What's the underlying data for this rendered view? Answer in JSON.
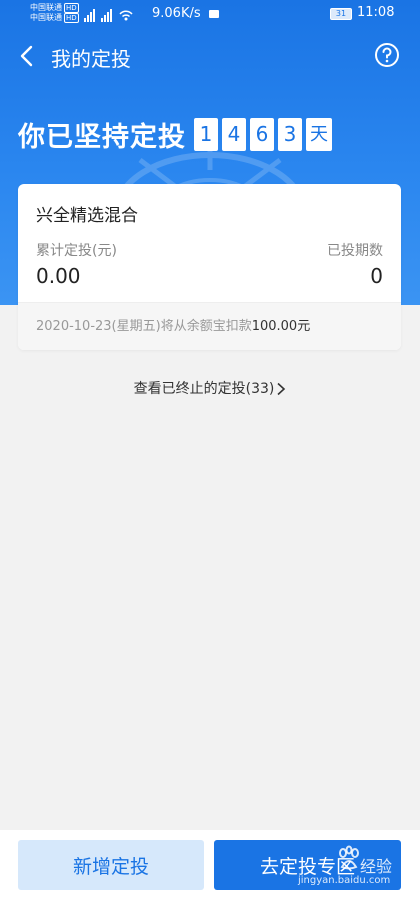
{
  "status_bar": {
    "carrier_1": "中国联通",
    "carrier_2": "中国联通",
    "hd_badge": "HD",
    "network_speed": "9.06K/s",
    "battery": "31",
    "time": "11:08"
  },
  "nav": {
    "title": "我的定投",
    "back_icon": "back-arrow-icon",
    "help_icon": "question-circle-icon"
  },
  "headline": {
    "text": "你已坚持定投",
    "digits": [
      "1",
      "4",
      "6",
      "3"
    ],
    "unit": "天"
  },
  "card": {
    "fund_name": "兴全精选混合",
    "cumulative_label": "累计定投(元)",
    "cumulative_value": "0.00",
    "periods_label": "已投期数",
    "periods_value": "0",
    "next_deduction_prefix": "2020-10-23(星期五)将从余额宝扣款",
    "next_deduction_amount": "100.00元"
  },
  "stopped_link": {
    "label": "查看已终止的定投(33)"
  },
  "bottom_bar": {
    "add_button": "新增定投",
    "zone_button": "去定投专区"
  },
  "watermark": {
    "brand": "经验",
    "url": "jingyan.baidu.com"
  },
  "colors": {
    "primary": "#1a74e4",
    "primary_light": "#d6e8fb",
    "background": "#f2f2f2"
  }
}
